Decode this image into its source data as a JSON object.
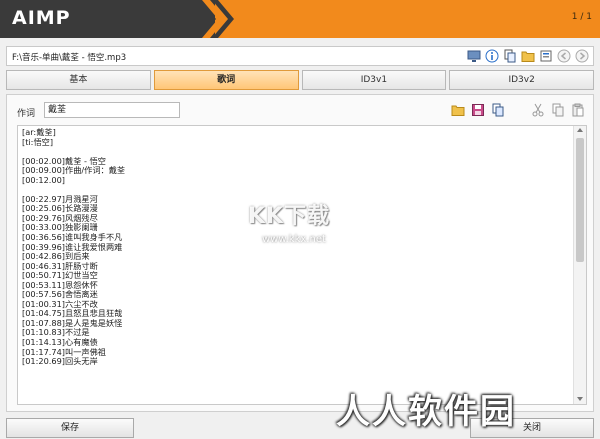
{
  "app": {
    "name": "AIMP",
    "page_counter": "1 / 1"
  },
  "path": {
    "value": "F:\\音乐-单曲\\戴荃 - 悟空.mp3"
  },
  "tabs": [
    {
      "label": "基本",
      "active": false
    },
    {
      "label": "歌词",
      "active": true
    },
    {
      "label": "ID3v1",
      "active": false
    },
    {
      "label": "ID3v2",
      "active": false
    }
  ],
  "lyrics_tab": {
    "artist_label": "作词",
    "artist_value": "戴荃",
    "lyrics": "[ar:戴荃]\n[ti:悟空]\n\n[00:02.00]戴荃 - 悟空\n[00:09.00]作曲/作词：戴荃\n[00:12.00]\n\n[00:22.97]月溅星河\n[00:25.06]长路漫漫\n[00:29.76]风烟残尽\n[00:33.00]独影阑珊\n[00:36.56]谁叫我身手不凡\n[00:39.96]谁让我爱恨两难\n[00:42.86]到后来\n[00:46.31]肝肠寸断\n[00:50.71]幻世当空\n[00:53.11]恩怨休怀\n[00:57.56]舍悟离迷\n[01:00.31]六尘不改\n[01:04.75]且怒且悲且狂哉\n[01:07.88]是人是鬼是妖怪\n[01:10.83]不过是\n[01:14.13]心有魔债\n[01:17.74]叫一声佛祖\n[01:20.69]回头无岸"
  },
  "buttons": {
    "save": "保存",
    "close": "关闭"
  },
  "watermarks": {
    "kk": "KK下载",
    "site": "www.kkx.net",
    "rr": "人人软件园"
  },
  "colors": {
    "accent": "#f28a1c",
    "header_dark": "#3a3a3a",
    "active_tab": "#ffc677"
  }
}
